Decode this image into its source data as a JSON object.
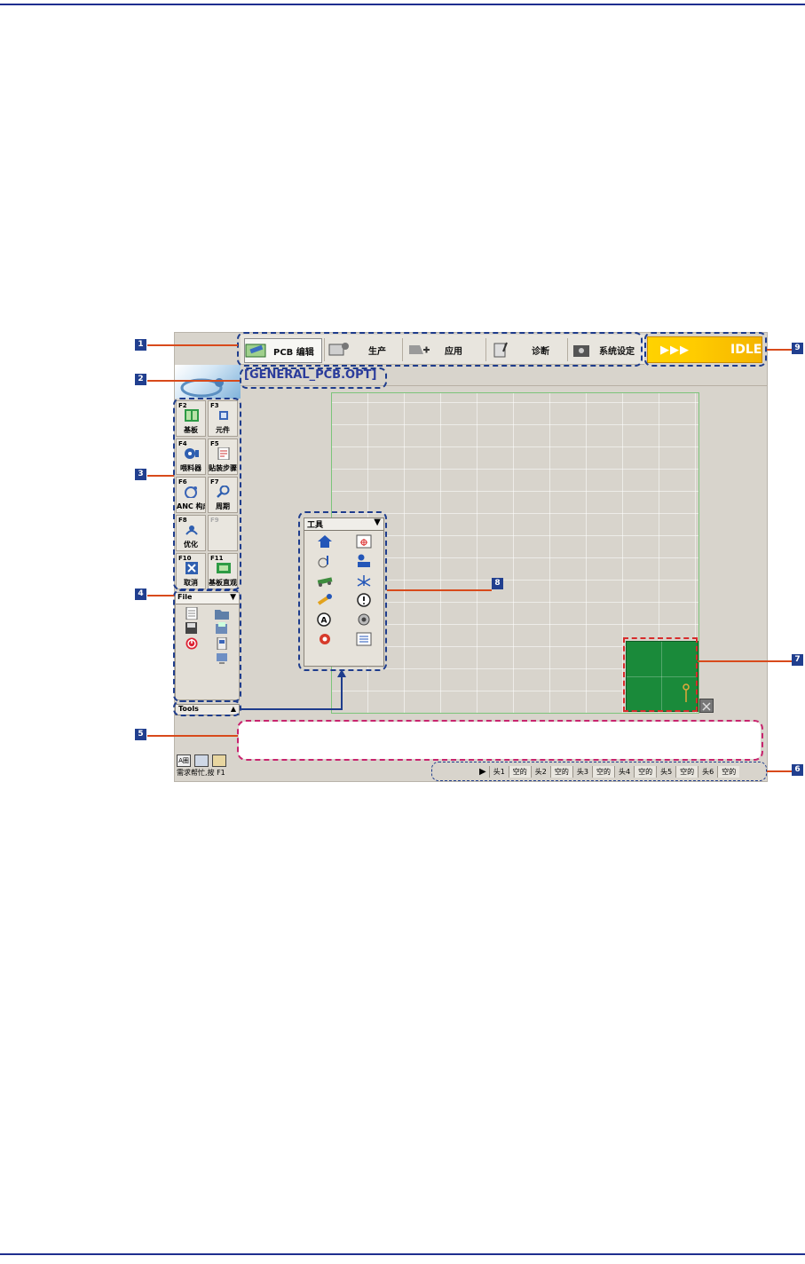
{
  "nav": {
    "tabs": [
      {
        "label": "PCB 编辑",
        "icon": "pcb-edit-icon"
      },
      {
        "label": "生产",
        "icon": "production-icon"
      },
      {
        "label": "应用",
        "icon": "application-icon"
      },
      {
        "label": "诊断",
        "icon": "diagnosis-icon"
      },
      {
        "label": "系统设定",
        "icon": "system-settings-icon"
      }
    ],
    "active_tab": "PCB 编辑"
  },
  "status": {
    "arrows": "▶▶▶",
    "state": "IDLE",
    "color": "#ffcc00"
  },
  "filename": "[GENERAL_PCB.OPT]",
  "fkeys": [
    {
      "key": "F2",
      "label": "基板",
      "icon": "board-icon"
    },
    {
      "key": "F3",
      "label": "元件",
      "icon": "component-icon"
    },
    {
      "key": "F4",
      "label": "喂料器",
      "icon": "feeder-icon"
    },
    {
      "key": "F5",
      "label": "贴装步骤",
      "icon": "placement-steps-icon"
    },
    {
      "key": "F6",
      "label": "ANC 构成",
      "icon": "anc-icon"
    },
    {
      "key": "F7",
      "label": "周期",
      "icon": "cycle-icon"
    },
    {
      "key": "F8",
      "label": "优化",
      "icon": "optimize-icon"
    },
    {
      "key": "F9",
      "label": "",
      "icon": ""
    },
    {
      "key": "F10",
      "label": "取消",
      "icon": "cancel-icon"
    },
    {
      "key": "F11",
      "label": "基板直观图",
      "icon": "board-view-icon"
    }
  ],
  "file_panel": {
    "title": "File",
    "toggle": "▼"
  },
  "tools_bar": {
    "title": "Tools",
    "toggle": "▲"
  },
  "tools_panel": {
    "title": "工具",
    "toggle": "▼"
  },
  "help_text": "需求帮忙,按 F1",
  "heads": [
    {
      "name": "头1",
      "value": "空的"
    },
    {
      "name": "头2",
      "value": "空的"
    },
    {
      "name": "头3",
      "value": "空的"
    },
    {
      "name": "头4",
      "value": "空的"
    },
    {
      "name": "头5",
      "value": "空的"
    },
    {
      "name": "头6",
      "value": "空的"
    }
  ],
  "play_symbol": "▶",
  "bottom_icons": [
    "A圈",
    "",
    ""
  ],
  "callouts": [
    "1",
    "2",
    "3",
    "4",
    "5",
    "6",
    "7",
    "8",
    "9"
  ],
  "colors": {
    "rule": "#1f2f8f",
    "annotation_blue": "#1e3c8c",
    "annotation_red": "#c8246e",
    "callout_line": "#d84a1b",
    "pcb": "#1a8a3a"
  }
}
